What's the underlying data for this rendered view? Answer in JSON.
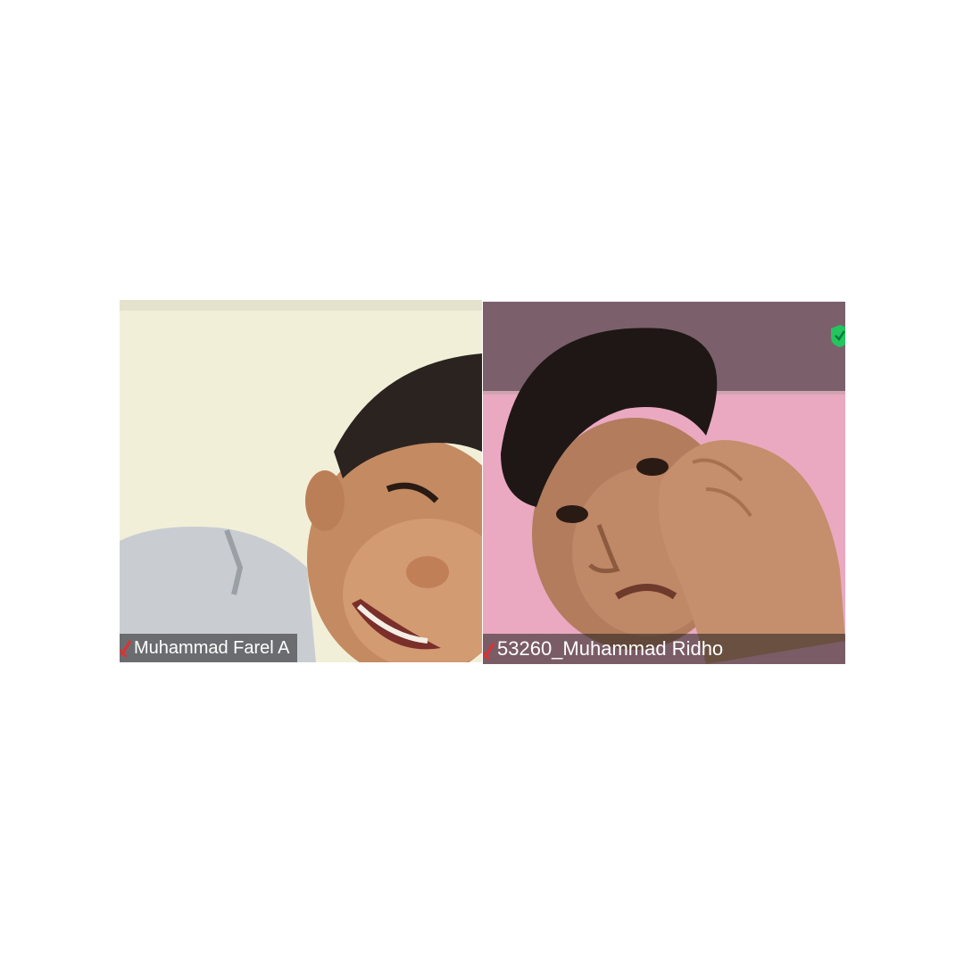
{
  "participants": [
    {
      "name": "Muhammad Farel A",
      "mic_icon": "muted-mic-icon"
    },
    {
      "name": "53260_Muhammad Ridho",
      "mic_icon": "muted-mic-icon",
      "status_icon": "active-speaker-shield-icon"
    }
  ],
  "colors": {
    "background": "#ffffff",
    "name_bar": "#1e1e1e",
    "name_text": "#ffffff",
    "muted_icon": "#e03030",
    "active_icon": "#22c55e"
  }
}
